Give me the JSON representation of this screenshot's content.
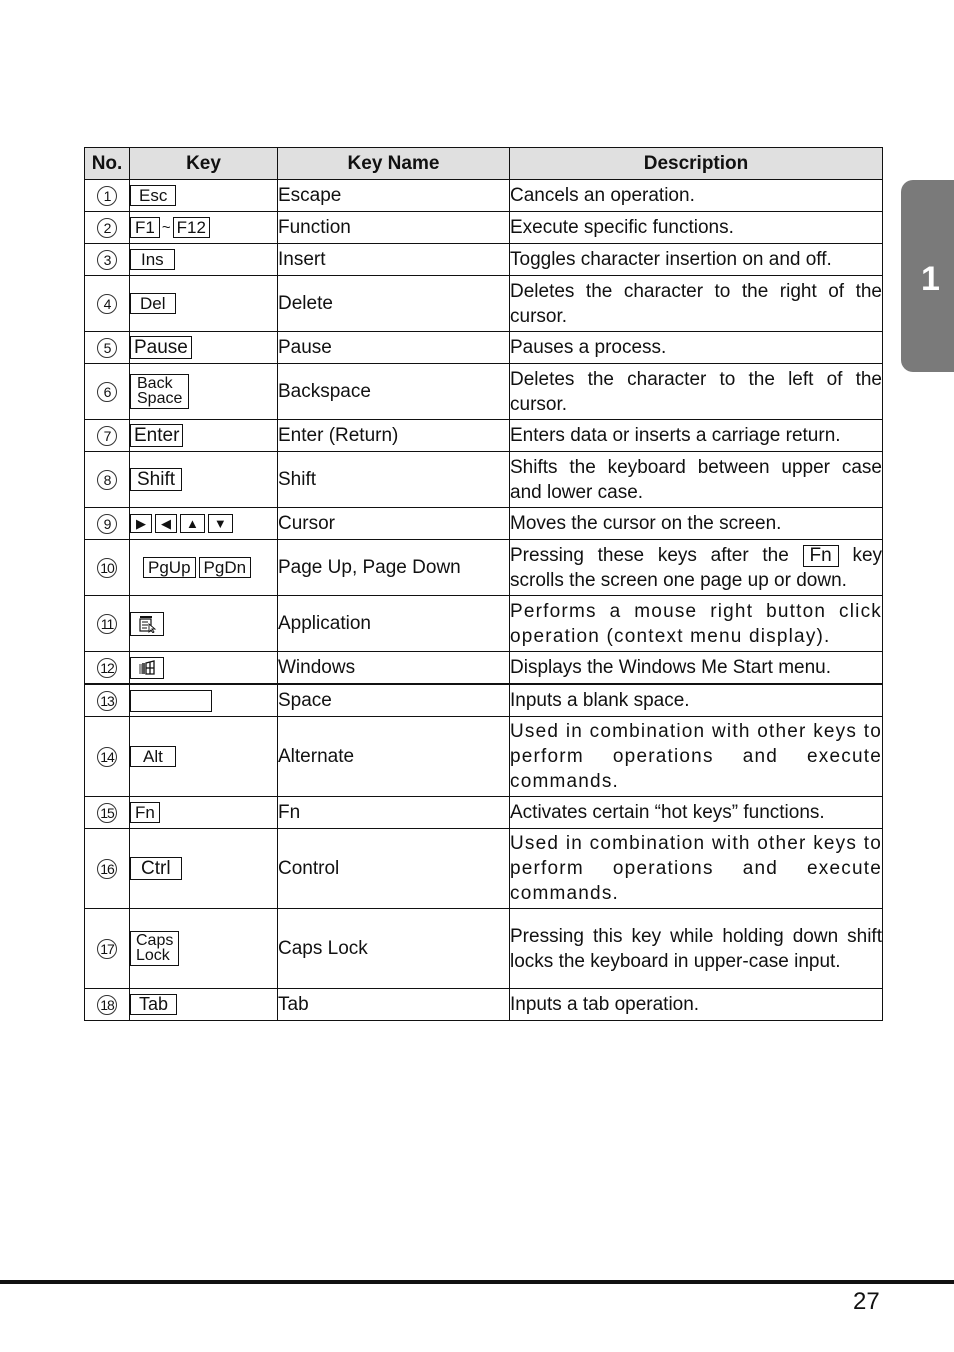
{
  "table": {
    "headers": {
      "no": "No.",
      "key": "Key",
      "key_name": "Key Name",
      "description": "Description"
    },
    "rows": [
      {
        "no": "1",
        "keys": [
          "Esc"
        ],
        "key_name": "Escape",
        "description": "Cancels an operation."
      },
      {
        "no": "2",
        "keys": [
          "F1",
          "F12"
        ],
        "separator": "~",
        "key_name": "Function",
        "description": "Execute specific functions."
      },
      {
        "no": "3",
        "keys": [
          "Ins"
        ],
        "key_name": "Insert",
        "description": "Toggles character insertion on and off."
      },
      {
        "no": "4",
        "keys": [
          "Del"
        ],
        "key_name": "Delete",
        "description": "Deletes the character to the right of the cursor."
      },
      {
        "no": "5",
        "keys": [
          "Pause"
        ],
        "key_name": "Pause",
        "description": "Pauses a process."
      },
      {
        "no": "6",
        "keys": [
          "Back",
          "Space"
        ],
        "key_name": "Backspace",
        "description": "Deletes the character to the left of the cursor."
      },
      {
        "no": "7",
        "keys": [
          "Enter"
        ],
        "key_name": "Enter (Return)",
        "description": "Enters data or inserts a carriage return."
      },
      {
        "no": "8",
        "keys": [
          "Shift"
        ],
        "key_name": "Shift",
        "description": "Shifts the keyboard between upper case and lower case."
      },
      {
        "no": "9",
        "keys": [
          "▶",
          "◀",
          "▲",
          "▼"
        ],
        "key_name": "Cursor",
        "description": "Moves the cursor on the screen."
      },
      {
        "no": "10",
        "keys": [
          "PgUp",
          "PgDn"
        ],
        "key_name": "Page Up, Page Down",
        "description_pre": "Pressing these keys after the",
        "description_key": "Fn",
        "description_post": "key scrolls the screen one page up or down."
      },
      {
        "no": "11",
        "keys": [
          "application-key-icon"
        ],
        "key_name": "Application",
        "description": "Performs a mouse right button click operation (context menu display)."
      },
      {
        "no": "12",
        "keys": [
          "windows-key-icon"
        ],
        "key_name": "Windows",
        "description": "Displays the Windows Me Start menu."
      },
      {
        "no": "13",
        "keys": [
          ""
        ],
        "key_name": "Space",
        "description": "Inputs a blank space."
      },
      {
        "no": "14",
        "keys": [
          "Alt"
        ],
        "key_name": "Alternate",
        "description": "Used in combination with other keys to perform operations and execute commands."
      },
      {
        "no": "15",
        "keys": [
          "Fn"
        ],
        "key_name": "Fn",
        "description": "Activates certain “hot keys” functions."
      },
      {
        "no": "16",
        "keys": [
          "Ctrl"
        ],
        "key_name": "Control",
        "description": "Used in combination with other keys to perform operations and execute commands."
      },
      {
        "no": "17",
        "keys": [
          "Caps",
          "Lock"
        ],
        "key_name": "Caps Lock",
        "description": "Pressing this key while holding down shift locks the keyboard in upper-case input."
      },
      {
        "no": "18",
        "keys": [
          "Tab"
        ],
        "key_name": "Tab",
        "description": "Inputs a tab operation."
      }
    ]
  },
  "chapter_tab": {
    "label": "1",
    "color": "#7a7a7a"
  },
  "page_number": "27"
}
